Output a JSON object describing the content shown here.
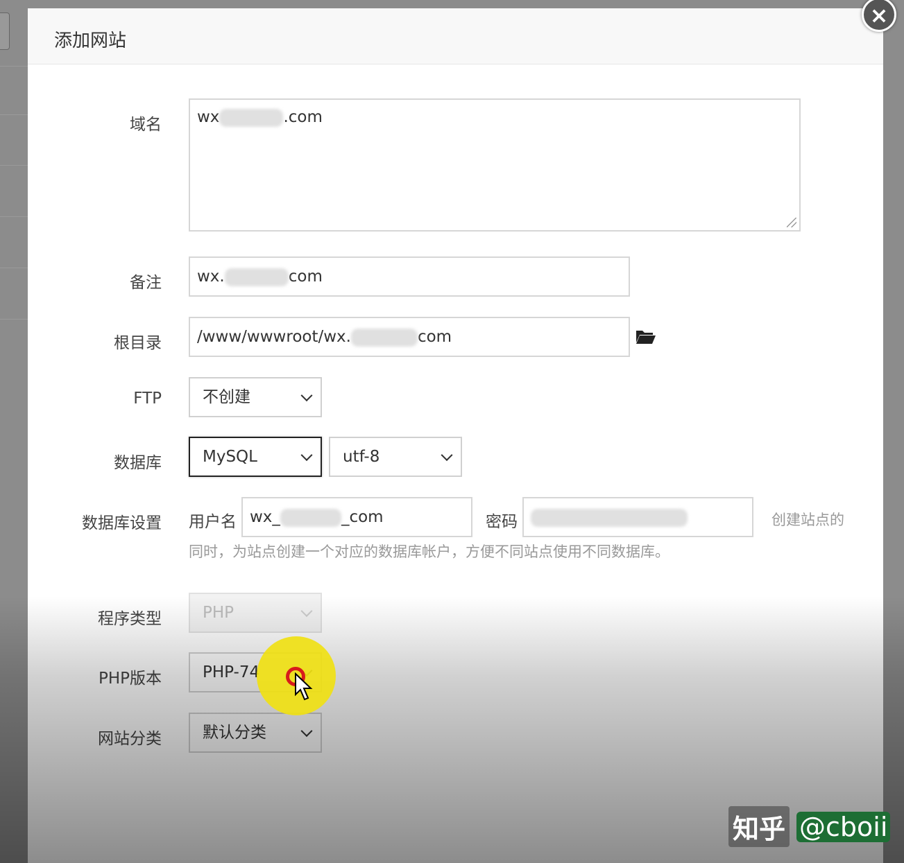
{
  "dialog": {
    "title": "添加网站",
    "close_label": "×"
  },
  "form": {
    "domain": {
      "label": "域名",
      "value_prefix": "wx",
      "value_suffix": ".com"
    },
    "note": {
      "label": "备注",
      "value_prefix": "wx.",
      "value_suffix": "com"
    },
    "root": {
      "label": "根目录",
      "value_prefix": "/www/wwwroot/wx.",
      "value_suffix": "com"
    },
    "ftp": {
      "label": "FTP",
      "value": "不创建"
    },
    "database": {
      "label": "数据库",
      "type": "MySQL",
      "charset": "utf-8"
    },
    "db_settings": {
      "label": "数据库设置",
      "username_label": "用户名",
      "username_prefix": "wx_",
      "username_suffix": "_com",
      "password_label": "密码",
      "hint_line1": "创建站点的",
      "hint_line2": "同时，为站点创建一个对应的数据库帐户，方便不同站点使用不同数据库。"
    },
    "program_type": {
      "label": "程序类型",
      "value": "PHP"
    },
    "php_version": {
      "label": "PHP版本",
      "value": "PHP-74"
    },
    "category": {
      "label": "网站分类",
      "value": "默认分类"
    }
  },
  "watermark": {
    "site": "知乎",
    "user": "@cboii"
  }
}
